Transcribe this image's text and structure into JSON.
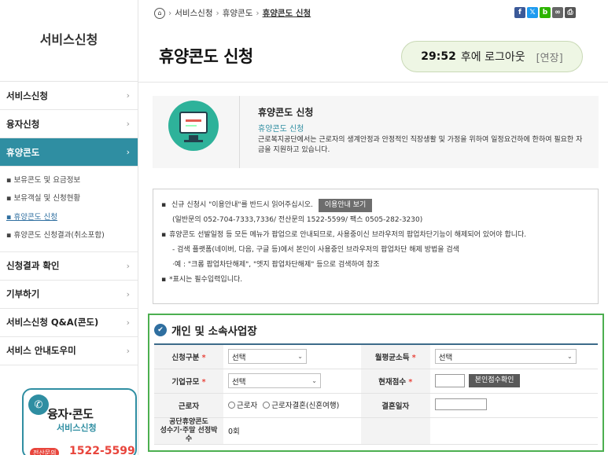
{
  "sidebar": {
    "title": "서비스신청",
    "menu": [
      {
        "label": "서비스신청"
      },
      {
        "label": "융자신청"
      },
      {
        "label": "휴양콘도"
      }
    ],
    "submenu": [
      {
        "label": "보유콘도 및 요금정보"
      },
      {
        "label": "보유객실 및 신청현황"
      },
      {
        "label": "휴양콘도 신청"
      },
      {
        "label": "휴양콘도 신청결과(취소포함)"
      }
    ],
    "menu_after": [
      {
        "label": "신청결과 확인"
      },
      {
        "label": "기부하기"
      },
      {
        "label": "서비스신청 Q&A(콘도)"
      },
      {
        "label": "서비스 안내도우미"
      }
    ],
    "banner": {
      "line1": "융자·콘도",
      "line2": "서비스신청",
      "tag": "전산문의",
      "phone": "1522-5599"
    }
  },
  "header": {
    "breadcrumb": [
      "서비스신청",
      "휴양콘도",
      "휴양콘도 신청"
    ],
    "page_title": "휴양콘도 신청",
    "timer": {
      "time": "29:52",
      "text": "후에 로그아웃",
      "extend": "[연장]"
    },
    "share_icons": [
      "f",
      "𝕏",
      "b",
      "∞",
      "⎙"
    ]
  },
  "intro": {
    "heading": "휴양콘도 신청",
    "sub": "휴양콘도 신청",
    "desc": "근로복지공단에서는 근로자의 생계안정과 안정적인 직장생활 및 가정을 위하여 일정요건하에 한하여 필요한 자금을 지원하고 있습니다."
  },
  "notice": {
    "line1": "신규 신청시 \"이용안내\"를 반드시 읽어주십시오.",
    "guide_button": "이용안내 보기",
    "line2": "(일반문의 052-704-7333,7336/ 전산문의 1522-5599/ 팩스 0505-282-3230)",
    "line3": "휴양콘도 선발일정 등 모든 메뉴가 팝업으로 안내되므로, 사용중이신 브라우저의 팝업차단기능이 해제되어 있어야 합니다.",
    "line4": "- 검색 플랫폼(네이버, 다음, 구글 등)에서 본인이 사용중인 브라우저의 팝업차단 해제 방법을 검색",
    "line5": "·예 : \"크롬 팝업차단해제\", \"엣지 팝업차단해제\" 등으로 검색하여 참조",
    "line6": "*표시는 필수입력입니다."
  },
  "form": {
    "section_title": "개인 및 소속사업장",
    "req_mark": "*",
    "apply_type_label": "신청구분",
    "apply_type_value": "선택",
    "income_label": "월평균소득",
    "income_value": "선택",
    "company_size_label": "기업규모",
    "company_size_value": "선택",
    "score_label": "현재점수",
    "score_button": "본인점수확인",
    "worker_label": "근로자",
    "worker_opt1": "근로자",
    "worker_opt2": "근로자결혼(신혼여행)",
    "wedding_label": "결혼일자",
    "usage_label_1": "공단휴양콘도",
    "usage_label_2": "성수기·주말 선정박수",
    "usage_value": "0회"
  }
}
